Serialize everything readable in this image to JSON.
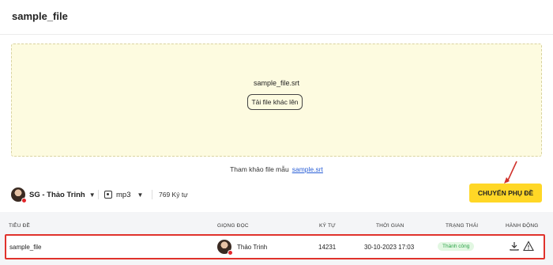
{
  "page": {
    "title": "sample_file"
  },
  "dropzone": {
    "file_name": "sample_file.srt",
    "reupload_label": "Tải file khác lên"
  },
  "sample": {
    "text": "Tham khảo file mẫu",
    "link": "sample.srt"
  },
  "controls": {
    "voice_label": "SG - Thảo Trinh",
    "format_label": "mp3",
    "char_count": "769 Ký tự",
    "convert_label": "CHUYỂN PHỤ ĐỀ"
  },
  "table": {
    "headers": [
      "TIÊU ĐỀ",
      "GIỌNG ĐỌC",
      "KÝ TỰ",
      "THỜI GIAN",
      "TRẠNG THÁI",
      "HÀNH ĐỘNG"
    ],
    "rows": [
      {
        "title": "sample_file",
        "voice": "Thảo Trinh",
        "chars": "14231",
        "time": "30-10-2023 17:03",
        "status": "Thành công"
      }
    ]
  },
  "colors": {
    "accent": "#ffd726",
    "highlight": "#e0322c",
    "success": "#2ea34a",
    "link": "#2a5fd6"
  },
  "icons": [
    "avatar",
    "chevron-down-icon",
    "audio-file-icon",
    "download-icon",
    "warning-icon",
    "arrow-annotation"
  ]
}
